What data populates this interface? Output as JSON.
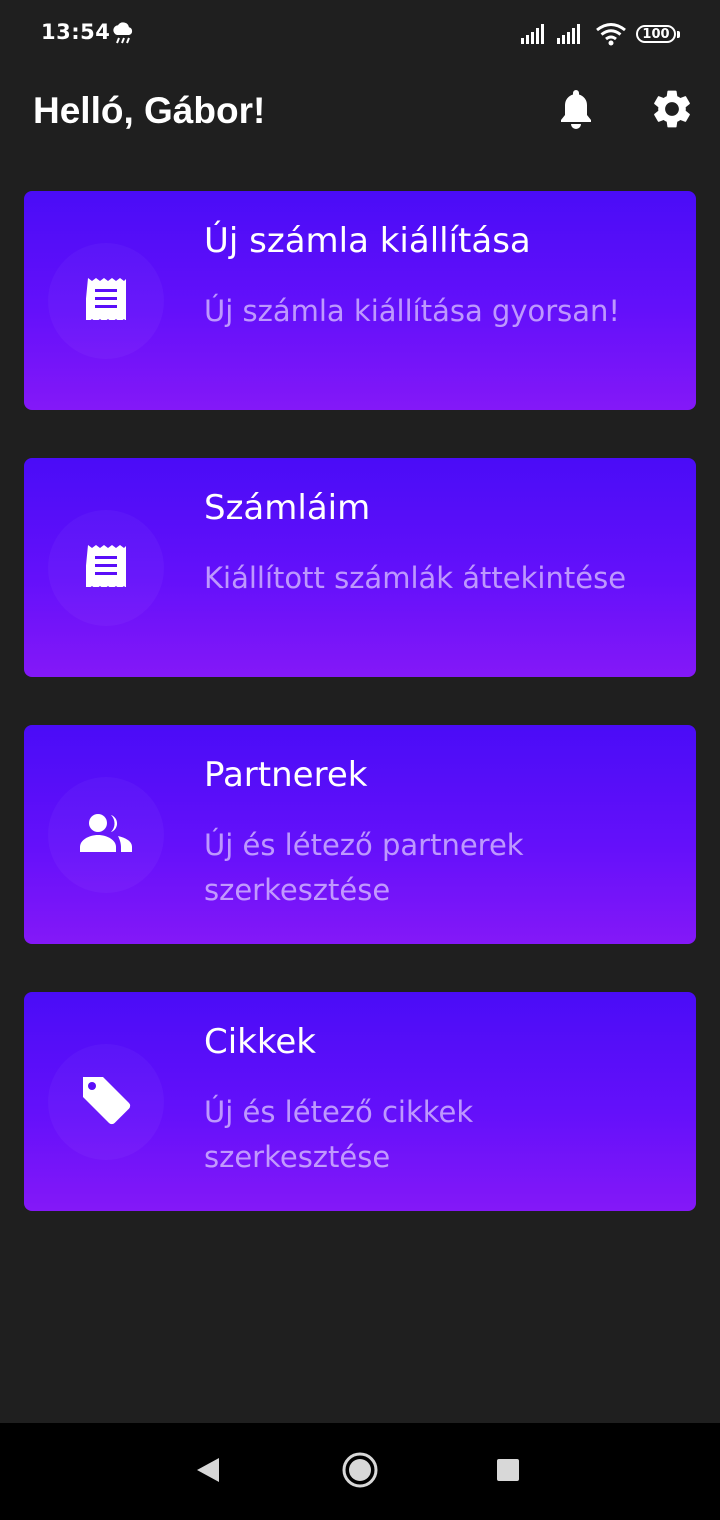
{
  "status_bar": {
    "time": "13:54",
    "battery": "100",
    "weather_icon": "cloud-rain-icon",
    "signal_icon": "signal-bars-icon",
    "wifi_icon": "wifi-icon"
  },
  "header": {
    "greeting": "Helló, Gábor!",
    "notifications_icon": "bell-icon",
    "settings_icon": "gear-icon"
  },
  "cards": [
    {
      "title": "Új számla kiállítása",
      "description": "Új számla kiállítása gyorsan!",
      "icon": "receipt-icon"
    },
    {
      "title": "Számláim",
      "description": "Kiállított számlák áttekintése",
      "icon": "receipt-icon"
    },
    {
      "title": "Partnerek",
      "description": "Új és létező partnerek szerkesztése",
      "icon": "people-icon"
    },
    {
      "title": "Cikkek",
      "description": "Új és létező cikkek szerkesztése",
      "icon": "tag-icon"
    }
  ],
  "colors": {
    "background": "#1f1f1f",
    "card_gradient_top": "#4a0cf7",
    "card_gradient_bottom": "#8418f8",
    "card_description": "#e1cdff",
    "nav_bar": "#000000"
  },
  "nav_bar": {
    "back_icon": "triangle-back-icon",
    "home_icon": "circle-home-icon",
    "recent_icon": "square-recent-icon"
  }
}
